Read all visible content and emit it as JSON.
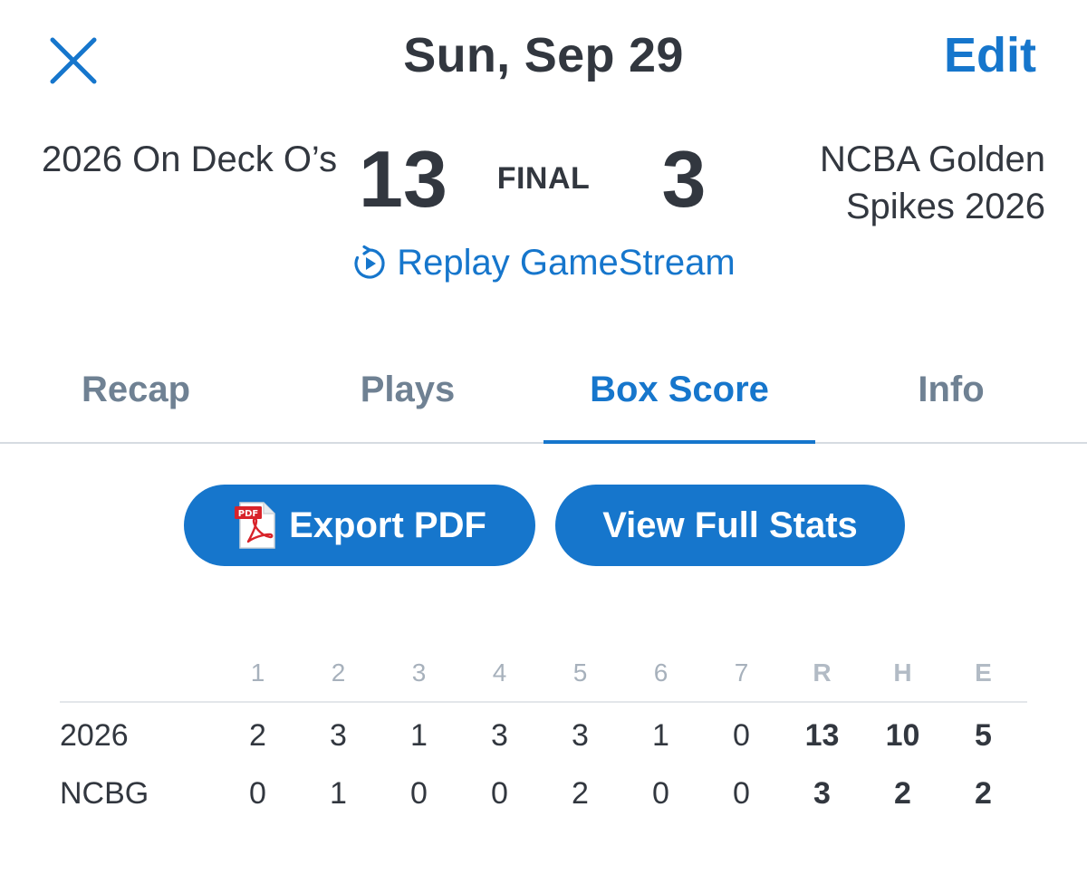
{
  "header": {
    "title": "Sun, Sep 29",
    "edit_label": "Edit",
    "close_icon": "close-icon"
  },
  "game": {
    "away_team": "2026 On Deck O’s",
    "home_team": "NCBA Golden Spikes 2026",
    "away_score": "13",
    "home_score": "3",
    "status": "FINAL",
    "replay_label": "Replay GameStream",
    "replay_icon": "replay-icon"
  },
  "tabs": [
    {
      "label": "Recap",
      "active": false
    },
    {
      "label": "Plays",
      "active": false
    },
    {
      "label": "Box Score",
      "active": true
    },
    {
      "label": "Info",
      "active": false
    }
  ],
  "actions": {
    "export_label": "Export PDF",
    "export_icon": "pdf-icon",
    "stats_label": "View Full Stats"
  },
  "linescore": {
    "columns": [
      "1",
      "2",
      "3",
      "4",
      "5",
      "6",
      "7",
      "R",
      "H",
      "E"
    ],
    "rows": [
      {
        "team": "2026",
        "innings": [
          "2",
          "3",
          "1",
          "3",
          "3",
          "1",
          "0"
        ],
        "totals": [
          "13",
          "10",
          "5"
        ]
      },
      {
        "team": "NCBG",
        "innings": [
          "0",
          "1",
          "0",
          "0",
          "2",
          "0",
          "0"
        ],
        "totals": [
          "3",
          "2",
          "2"
        ]
      }
    ]
  },
  "colors": {
    "accent": "#1676cc",
    "text": "#32373f",
    "muted_tab": "#6f8193",
    "header_muted": "#a7b1bc"
  }
}
